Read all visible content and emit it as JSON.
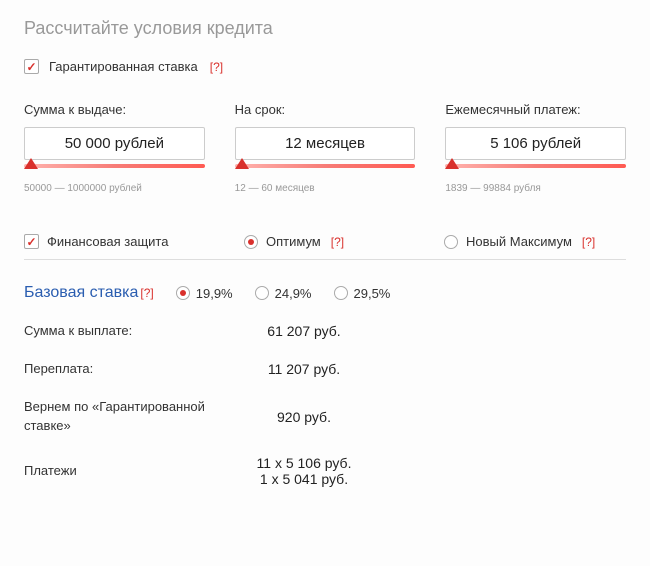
{
  "title": "Рассчитайте условия кредита",
  "guaranteed_rate": {
    "label": "Гарантированная ставка",
    "help": "[?]"
  },
  "sliders": {
    "amount": {
      "label": "Сумма к выдаче:",
      "value": "50 000 рублей",
      "range": "50000 — 1000000 рублей"
    },
    "term": {
      "label": "На срок:",
      "value": "12 месяцев",
      "range": "12 — 60 месяцев"
    },
    "payment": {
      "label": "Ежемесячный платеж:",
      "value": "5 106 рублей",
      "range": "1839 — 99884 рубля"
    }
  },
  "protection": {
    "label": "Финансовая защита",
    "option1": {
      "label": "Оптимум",
      "help": "[?]"
    },
    "option2": {
      "label": "Новый Максимум",
      "help": "[?]"
    }
  },
  "base_rate": {
    "title": "Базовая ставка",
    "help": "[?]",
    "opt1": "19,9%",
    "opt2": "24,9%",
    "opt3": "29,5%"
  },
  "summary": {
    "total_label": "Сумма к выплате:",
    "total_value": "61 207 руб.",
    "overpay_label": "Переплата:",
    "overpay_value": "11 207 руб.",
    "refund_label": "Вернем по «Гарантированной ставке»",
    "refund_value": "920 руб.",
    "payments_label": "Платежи",
    "payments_line1": "11 x 5 106 руб.",
    "payments_line2": "1 x 5 041 руб."
  }
}
